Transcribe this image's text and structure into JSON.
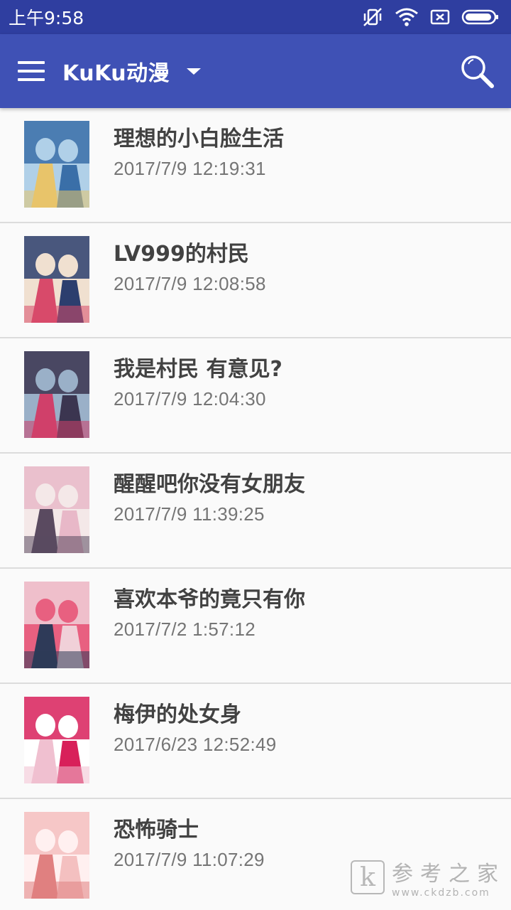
{
  "status_bar": {
    "time": "上午9:58",
    "icons": [
      "vibrate-off-icon",
      "wifi-icon",
      "sim-none-icon",
      "battery-icon"
    ]
  },
  "app_bar": {
    "title": "KuKu动漫",
    "color": "#3f51b5",
    "status_color": "#2f3ea0"
  },
  "items": [
    {
      "title": "理想的小白脸生活",
      "date": "2017/7/9 12:19:31",
      "cover_colors": [
        "#3a6fa8",
        "#e8c46a",
        "#b0d0e8"
      ]
    },
    {
      "title": "LV999的村民",
      "date": "2017/7/9 12:08:58",
      "cover_colors": [
        "#2c3e6e",
        "#d84a6a",
        "#f0e0d0"
      ]
    },
    {
      "title": "我是村民 有意见?",
      "date": "2017/7/9 12:04:30",
      "cover_colors": [
        "#3b3550",
        "#d0406a",
        "#9ab0c8"
      ]
    },
    {
      "title": "醒醒吧你没有女朋友",
      "date": "2017/7/9 11:39:25",
      "cover_colors": [
        "#e8b8c8",
        "#5a4a60",
        "#f4e8e8"
      ]
    },
    {
      "title": "喜欢本爷的竟只有你",
      "date": "2017/7/2 1:57:12",
      "cover_colors": [
        "#f0d0d8",
        "#2e3a58",
        "#e86080"
      ]
    },
    {
      "title": "梅伊的处女身",
      "date": "2017/6/23 12:52:49",
      "cover_colors": [
        "#d8205a",
        "#f0c0d0",
        "#ffffff"
      ]
    },
    {
      "title": "恐怖骑士",
      "date": "2017/7/9 11:07:29",
      "cover_colors": [
        "#f4c0c0",
        "#e08080",
        "#fff0f0"
      ]
    }
  ],
  "watermark": {
    "mark": "k",
    "text": "参考之家",
    "url": "www.ckdzb.com"
  }
}
